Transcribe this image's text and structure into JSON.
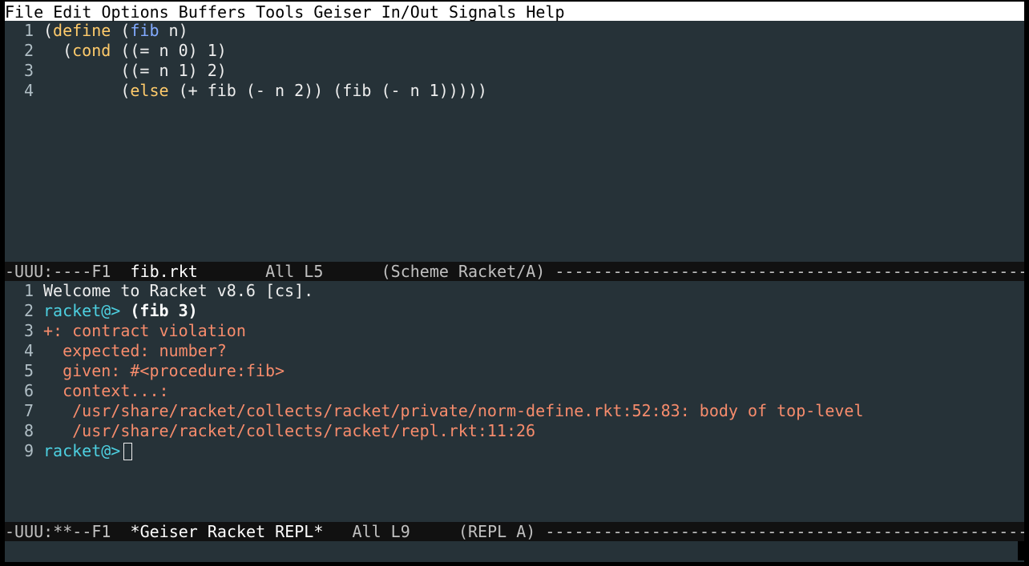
{
  "menubar": [
    "File",
    "Edit",
    "Options",
    "Buffers",
    "Tools",
    "Geiser",
    "In/Out",
    "Signals",
    "Help"
  ],
  "editor": {
    "line_numbers": [
      "1",
      "2",
      "3",
      "4"
    ],
    "l1": {
      "open": "(",
      "kw": "define",
      "sp": " (",
      "name": "fib",
      "rest": " n)"
    },
    "l2": {
      "indent": "  (",
      "kw": "cond",
      "rest": " ((= n 0) 1)"
    },
    "l3": {
      "indent": "        ",
      "rest": "((= n 1) 2)"
    },
    "l4": {
      "indent": "        (",
      "kw": "else",
      "rest": " (+ fib (- n 2)) (fib (- n 1)))))"
    }
  },
  "modeline_top": {
    "status": "-UUU:----F1  ",
    "buffer": "fib.rkt",
    "position": "       All L5      ",
    "mode": "(Scheme Racket/A) ",
    "dashes": "-------------------------------------------------------------------------------------------------------"
  },
  "repl": {
    "line_numbers": [
      "1",
      "2",
      "3",
      "4",
      "5",
      "6",
      "7",
      "8",
      "9"
    ],
    "welcome": "Welcome to Racket v8.6 [cs].",
    "prompt": "racket@>",
    "input": "(fib 3)",
    "errors": [
      "+: contract violation",
      "  expected: number?",
      "  given: #<procedure:fib>",
      "  context...:",
      "   /usr/share/racket/collects/racket/private/norm-define.rkt:52:83: body of top-level",
      "   /usr/share/racket/collects/racket/repl.rkt:11:26"
    ],
    "prompt2": "racket@>"
  },
  "modeline_bottom": {
    "status": "-UUU:**--F1  ",
    "buffer": "*Geiser Racket REPL*",
    "position": "   All L9     ",
    "mode": "(REPL A) ",
    "dashes": "-------------------------------------------------------------------------------------------------------"
  },
  "colors": {
    "background": "#263238",
    "keyword": "#ffcb6b",
    "function": "#82aaff",
    "prompt": "#4dd0e1",
    "error": "#f78c6c"
  }
}
